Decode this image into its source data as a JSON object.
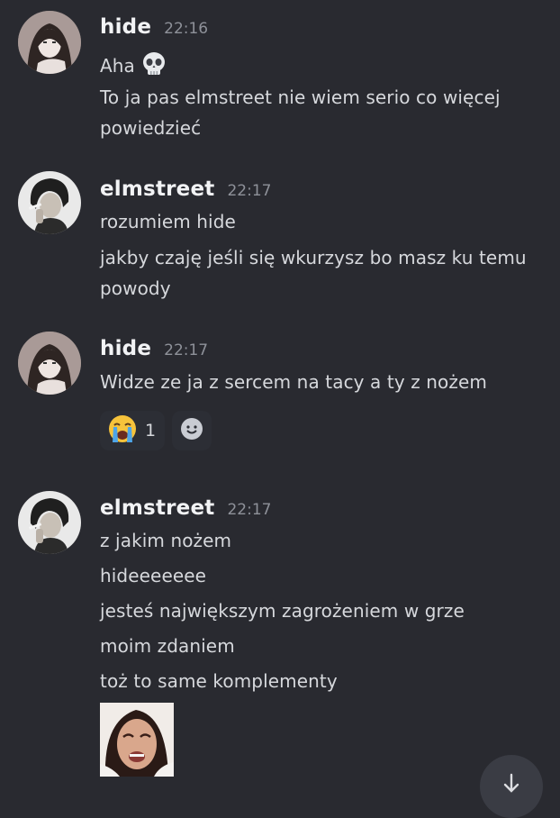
{
  "messages": [
    {
      "author": "hide",
      "time": "22:16",
      "lines": [
        "Aha",
        "To ja pas elmstreet nie wiem serio co więcej",
        "powiedzieć"
      ],
      "first_line_emoji": "skull-emoji"
    },
    {
      "author": "elmstreet",
      "time": "22:17",
      "lines": [
        "rozumiem hide",
        "jakby czaję jeśli się wkurzysz bo masz ku temu",
        "powody"
      ]
    },
    {
      "author": "hide",
      "time": "22:17",
      "lines": [
        "Widze ze ja z sercem na tacy a ty z nożem"
      ],
      "reactions": [
        {
          "emoji": "loudly-crying-face-emoji",
          "count": "1"
        }
      ],
      "add_reaction_icon": "add-reaction-icon"
    },
    {
      "author": "elmstreet",
      "time": "22:17",
      "lines": [
        "z jakim nożem",
        "hideeeeeee",
        "jesteś największym zagrożeniem w grze",
        "moim zdaniem",
        "toż to same komplementy"
      ],
      "attachment": "crying-face-gif"
    }
  ],
  "scroll_button_icon": "jump-to-present-icon",
  "colors": {
    "background": "#292a30",
    "username": "#f2f3f5",
    "text": "#d6d8dc",
    "timestamp": "#8e9199"
  }
}
